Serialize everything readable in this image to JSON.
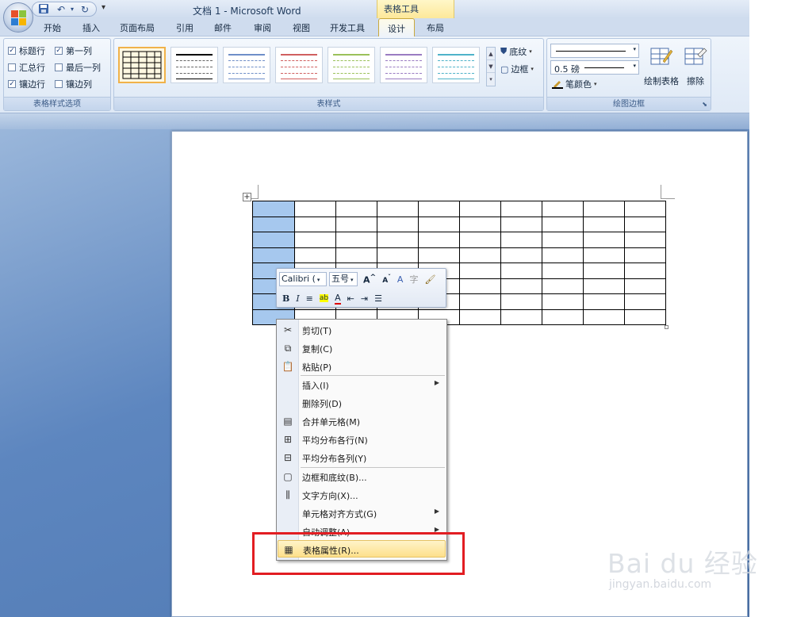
{
  "window": {
    "title": "文档 1 - Microsoft Word",
    "context_group": "表格工具"
  },
  "quick_access": {
    "save_icon": "save-icon",
    "undo_icon": "undo-icon",
    "redo_icon": "redo-icon",
    "more": "▾"
  },
  "tabs": [
    "开始",
    "插入",
    "页面布局",
    "引用",
    "邮件",
    "审阅",
    "视图",
    "开发工具"
  ],
  "context_tabs": {
    "design": "设计",
    "layout": "布局"
  },
  "ribbon": {
    "style_options": {
      "label": "表格样式选项",
      "items": [
        {
          "label": "标题行",
          "checked": true
        },
        {
          "label": "第一列",
          "checked": true
        },
        {
          "label": "汇总行",
          "checked": false
        },
        {
          "label": "最后一列",
          "checked": false
        },
        {
          "label": "镶边行",
          "checked": true
        },
        {
          "label": "镶边列",
          "checked": false
        }
      ]
    },
    "table_styles": {
      "label": "表样式",
      "shading": "底纹",
      "borders": "边框",
      "swatch_colors": [
        "#000000",
        "#555555",
        "#6f8fc8",
        "#d06060",
        "#9bc15a",
        "#9a7cc2",
        "#4fb3c9"
      ]
    },
    "draw_borders": {
      "label": "绘图边框",
      "weight": "0.5 磅",
      "pen_color": "笔颜色",
      "draw_table": "绘制表格",
      "eraser": "擦除"
    }
  },
  "mini_toolbar": {
    "font": "Calibri (",
    "size": "五号",
    "row2": [
      "B",
      "I",
      "≡",
      "ab",
      "A",
      "⇤",
      "⇥",
      "☰"
    ]
  },
  "context_menu": {
    "items": [
      {
        "label": "剪切(T)",
        "icon": "scissors-icon",
        "glyph": "✂"
      },
      {
        "label": "复制(C)",
        "icon": "copy-icon",
        "glyph": "⧉"
      },
      {
        "label": "粘贴(P)",
        "icon": "paste-icon",
        "glyph": "📋"
      },
      {
        "label": "插入(I)",
        "icon": "",
        "glyph": "",
        "submenu": true
      },
      {
        "label": "删除列(D)",
        "icon": "",
        "glyph": ""
      },
      {
        "label": "合并单元格(M)",
        "icon": "merge-cells-icon",
        "glyph": "▤"
      },
      {
        "label": "平均分布各行(N)",
        "icon": "distribute-rows-icon",
        "glyph": "⊞"
      },
      {
        "label": "平均分布各列(Y)",
        "icon": "distribute-columns-icon",
        "glyph": "⊟"
      },
      {
        "label": "边框和底纹(B)...",
        "icon": "borders-shading-icon",
        "glyph": "▢"
      },
      {
        "label": "文字方向(X)...",
        "icon": "text-direction-icon",
        "glyph": "⫼"
      },
      {
        "label": "单元格对齐方式(G)",
        "icon": "",
        "glyph": "",
        "submenu": true
      },
      {
        "label": "自动调整(A)",
        "icon": "",
        "glyph": "",
        "submenu": true
      },
      {
        "label": "表格属性(R)...",
        "icon": "table-properties-icon",
        "glyph": "▦"
      }
    ]
  },
  "table": {
    "rows": 8,
    "cols": 10
  },
  "watermark": {
    "main": "Bai du 经验",
    "sub": "jingyan.baidu.com"
  },
  "colors": {
    "highlight_red": "#e21d22",
    "selected_col": "#a6c8ee",
    "menu_hover": "#fde08b"
  }
}
